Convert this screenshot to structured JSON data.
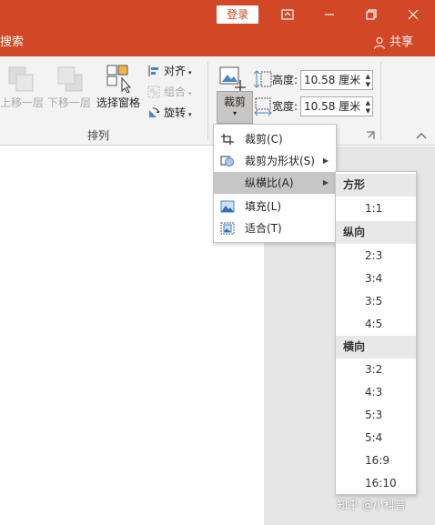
{
  "titlebar": {
    "login_label": "登录",
    "icons": [
      "ribbon-display-icon",
      "minimize-icon",
      "restore-icon",
      "close-icon"
    ]
  },
  "tabs": {
    "search_label": "搜索",
    "share_label": "共享"
  },
  "ribbon": {
    "bring_forward": "上移一层",
    "send_backward": "下移一层",
    "selection_pane": "选择窗格",
    "align": "对齐",
    "group": "组合",
    "rotate": "旋转",
    "arrange_group": "排列",
    "crop": "裁剪",
    "height_label": "高度:",
    "height_value": "10.58 厘米",
    "width_label": "宽度:",
    "width_value": "10.58 厘米"
  },
  "crop_menu": {
    "items": [
      {
        "label": "裁剪(C)",
        "icon": "crop-icon"
      },
      {
        "label": "裁剪为形状(S)",
        "icon": "shape-icon",
        "has_submenu": true
      },
      {
        "label": "纵横比(A)",
        "icon": "",
        "has_submenu": true,
        "highlighted": true
      },
      {
        "label": "填充(L)",
        "icon": "fill-icon"
      },
      {
        "label": "适合(T)",
        "icon": "fit-icon"
      }
    ]
  },
  "ratio_menu": {
    "square_header": "方形",
    "square_items": [
      "1:1"
    ],
    "portrait_header": "纵向",
    "portrait_items": [
      "2:3",
      "3:4",
      "3:5",
      "4:5"
    ],
    "landscape_header": "横向",
    "landscape_items": [
      "3:2",
      "4:3",
      "5:3",
      "5:4",
      "16:9",
      "16:10"
    ]
  },
  "watermark": "知乎 @小科普",
  "colors": {
    "accent": "#d24726",
    "ribbon_bg": "#f3f3f3",
    "highlight": "#c6c6c6"
  }
}
